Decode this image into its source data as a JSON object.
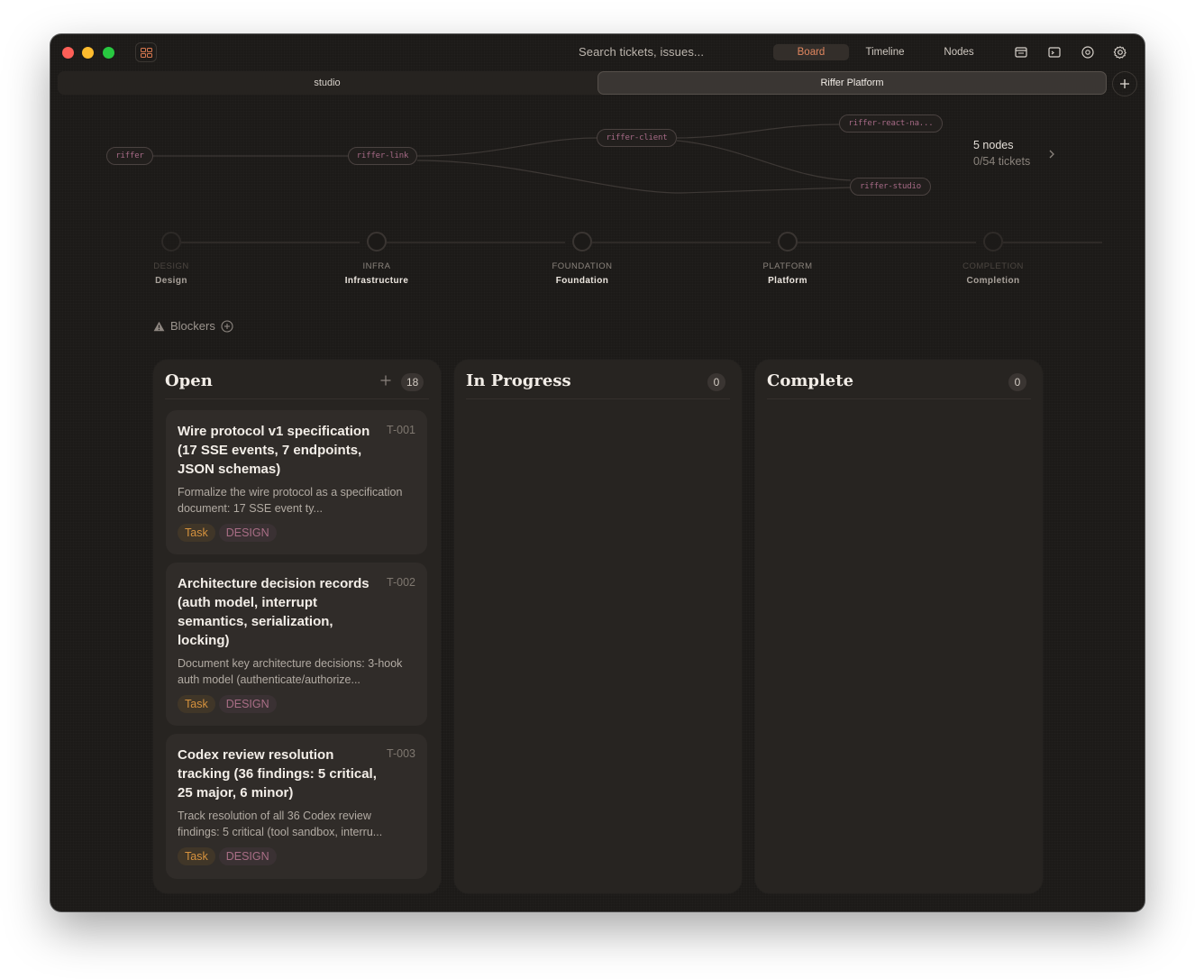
{
  "titlebar": {
    "search_placeholder": "Search tickets, issues...",
    "views": [
      "Board",
      "Timeline",
      "Nodes"
    ],
    "active_view": "Board"
  },
  "tabs": [
    {
      "label": "studio",
      "active": false
    },
    {
      "label": "Riffer Platform",
      "active": true
    }
  ],
  "graph": {
    "nodes": [
      "riffer",
      "riffer-link",
      "riffer-client",
      "riffer-react-na...",
      "riffer-studio"
    ],
    "stats": {
      "nodes": "5 nodes",
      "tickets": "0/54 tickets"
    }
  },
  "phases": [
    {
      "code": "DESIGN",
      "name": "Design"
    },
    {
      "code": "INFRA",
      "name": "Infrastructure"
    },
    {
      "code": "FOUNDATION",
      "name": "Foundation"
    },
    {
      "code": "PLATFORM",
      "name": "Platform"
    },
    {
      "code": "COMPLETION",
      "name": "Completion"
    }
  ],
  "blockers": {
    "label": "Blockers"
  },
  "columns": [
    {
      "title": "Open",
      "count": "18"
    },
    {
      "title": "In Progress",
      "count": "0"
    },
    {
      "title": "Complete",
      "count": "0"
    }
  ],
  "cards": [
    {
      "id": "T-001",
      "title": "Wire protocol v1 specification (17 SSE events, 7 endpoints, JSON schemas)",
      "desc": "Formalize the wire protocol as a specification document: 17 SSE event ty...",
      "tags": [
        "Task",
        "DESIGN"
      ]
    },
    {
      "id": "T-002",
      "title": "Architecture decision records (auth model, interrupt semantics, serialization, locking)",
      "desc": "Document key architecture decisions: 3-hook auth model (authenticate/authorize...",
      "tags": [
        "Task",
        "DESIGN"
      ]
    },
    {
      "id": "T-003",
      "title": "Codex review resolution tracking (36 findings: 5 critical, 25 major, 6 minor)",
      "desc": "Track resolution of all 36 Codex review findings: 5 critical (tool sandbox, interru...",
      "tags": [
        "Task",
        "DESIGN"
      ]
    }
  ],
  "colors": {
    "accent": "#e0865f",
    "task_tag": "#d6923e",
    "design_tag": "#a96e86",
    "node_text": "#a66a86"
  }
}
